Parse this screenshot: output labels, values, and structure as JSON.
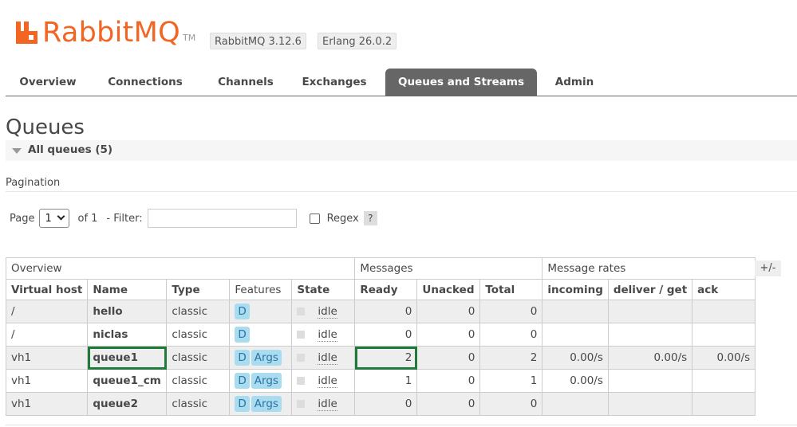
{
  "brand": {
    "logo_text": "RabbitMQ",
    "tm": "TM",
    "version": "RabbitMQ 3.12.6",
    "erlang": "Erlang 26.0.2",
    "accent": "#f26522"
  },
  "nav": {
    "tabs": [
      {
        "label": "Overview"
      },
      {
        "label": "Connections"
      },
      {
        "label": "Channels"
      },
      {
        "label": "Exchanges"
      },
      {
        "label": "Queues and Streams",
        "active": true
      },
      {
        "label": "Admin"
      }
    ]
  },
  "page": {
    "title": "Queues",
    "section": "All queues (5)"
  },
  "pagination": {
    "title": "Pagination",
    "page_label": "Page",
    "page_value": "1",
    "of_label": "of 1",
    "filter_label": "- Filter:",
    "filter_value": "",
    "regex_label": "Regex",
    "help": "?"
  },
  "table": {
    "groups": [
      "Overview",
      "Messages",
      "Message rates"
    ],
    "toggle": "+/-",
    "columns": [
      "Virtual host",
      "Name",
      "Type",
      "Features",
      "State",
      "Ready",
      "Unacked",
      "Total",
      "incoming",
      "deliver / get",
      "ack"
    ],
    "rows": [
      {
        "vhost": "/",
        "name": "hello",
        "type": "classic",
        "features": [
          "D"
        ],
        "state": "idle",
        "ready": "0",
        "unacked": "0",
        "total": "0",
        "incoming": "",
        "deliver": "",
        "ack": ""
      },
      {
        "vhost": "/",
        "name": "niclas",
        "type": "classic",
        "features": [
          "D"
        ],
        "state": "idle",
        "ready": "0",
        "unacked": "0",
        "total": "0",
        "incoming": "",
        "deliver": "",
        "ack": ""
      },
      {
        "vhost": "vh1",
        "name": "queue1",
        "type": "classic",
        "features": [
          "D",
          "Args"
        ],
        "state": "idle",
        "ready": "2",
        "unacked": "0",
        "total": "2",
        "incoming": "0.00/s",
        "deliver": "0.00/s",
        "ack": "0.00/s"
      },
      {
        "vhost": "vh1",
        "name": "queue1_cm",
        "type": "classic",
        "features": [
          "D",
          "Args"
        ],
        "state": "idle",
        "ready": "1",
        "unacked": "0",
        "total": "1",
        "incoming": "0.00/s",
        "deliver": "",
        "ack": ""
      },
      {
        "vhost": "vh1",
        "name": "queue2",
        "type": "classic",
        "features": [
          "D",
          "Args"
        ],
        "state": "idle",
        "ready": "0",
        "unacked": "0",
        "total": "0",
        "incoming": "",
        "deliver": "",
        "ack": ""
      }
    ]
  }
}
